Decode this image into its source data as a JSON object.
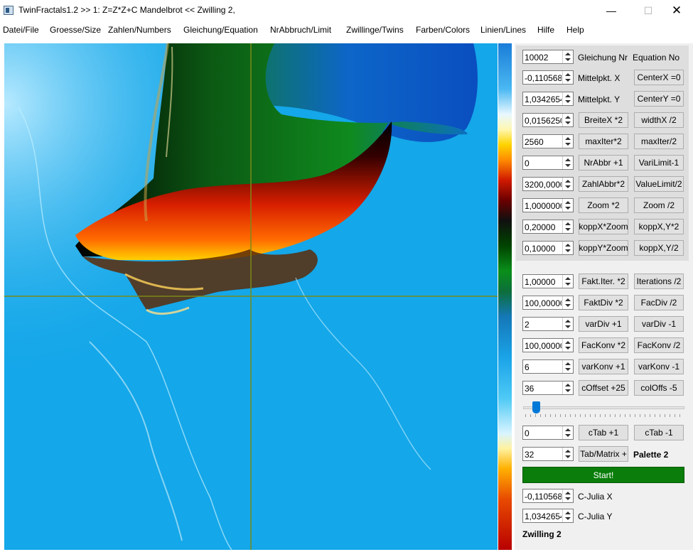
{
  "window": {
    "title": "TwinFractals1.2 >> 1: Z=Z*Z+C Mandelbrot << Zwilling 2,",
    "minimize_glyph": "—",
    "maximize_glyph": "☐",
    "close_glyph": "✕"
  },
  "menu": [
    {
      "label": "Datei/File"
    },
    {
      "label": "Groesse/Size"
    },
    {
      "label": "Zahlen/Numbers"
    },
    {
      "label": "Gleichung/Equation"
    },
    {
      "label": "NrAbbruch/Limit"
    },
    {
      "label": "Zwillinge/Twins"
    },
    {
      "label": "Farben/Colors"
    },
    {
      "label": "Linien/Lines"
    },
    {
      "label": "Hilfe"
    },
    {
      "label": "Help"
    }
  ],
  "controls": {
    "equation": {
      "value": "10002",
      "label1": "Gleichung Nr",
      "label2": "Equation No"
    },
    "center_x": {
      "value": "-0,1105682",
      "label": "Mittelpkt. X",
      "button": "CenterX =0"
    },
    "center_y": {
      "value": "1,03426542",
      "label": "Mittelpkt. Y",
      "button": "CenterY =0"
    },
    "width": {
      "value": "0,01562500",
      "button1": "BreiteX *2",
      "button2": "widthX /2"
    },
    "max_iter": {
      "value": "2560",
      "button1": "maxIter*2",
      "button2": "maxIter/2"
    },
    "nr_abbr": {
      "value": "0",
      "button1": "NrAbbr +1",
      "button2": "VariLimit-1"
    },
    "zahl_abbr": {
      "value": "3200,00000",
      "button1": "ZahlAbbr*2",
      "button2": "ValueLimit/2"
    },
    "zoom": {
      "value": "1,00000000",
      "button1": "Zoom *2",
      "button2": "Zoom /2"
    },
    "kopp_x": {
      "value": "0,20000",
      "button1": "koppX*Zoom",
      "button2": "koppX,Y*2"
    },
    "kopp_y": {
      "value": "0,10000",
      "button1": "koppY*Zoom",
      "button2": "koppX,Y/2"
    },
    "fakt_iter": {
      "value": "1,00000",
      "button1": "Fakt.Iter. *2",
      "button2": "Iterations /2"
    },
    "fakt_div": {
      "value": "100,00000",
      "button1": "FaktDiv *2",
      "button2": "FacDiv /2"
    },
    "var_div": {
      "value": "2",
      "button1": "varDiv +1",
      "button2": "varDiv -1"
    },
    "fac_konv": {
      "value": "100,00000",
      "button1": "FacKonv *2",
      "button2": "FacKonv /2"
    },
    "var_konv": {
      "value": "6",
      "button1": "varKonv +1",
      "button2": "varKonv -1"
    },
    "c_offset": {
      "value": "36",
      "button1": "cOffset +25",
      "button2": "colOffs -5"
    },
    "slider": {
      "value_fraction": 0.06
    },
    "c_tab": {
      "value": "0",
      "button1": "cTab +1",
      "button2": "cTab -1"
    },
    "tab_matrix": {
      "value": "32",
      "button": "Tab/Matrix +",
      "palette_label": "Palette 2"
    },
    "start_label": "Start!",
    "c_julia_x": {
      "value": "-0,1105682",
      "label": "C-Julia X"
    },
    "c_julia_y": {
      "value": "1,03426542",
      "label": "C-Julia Y"
    },
    "twin_label": "Zwilling 2"
  },
  "colors": {
    "fractal_background": "#14a7e9",
    "start_button": "#0a7d0a",
    "crosshair": "#7a8a18"
  }
}
